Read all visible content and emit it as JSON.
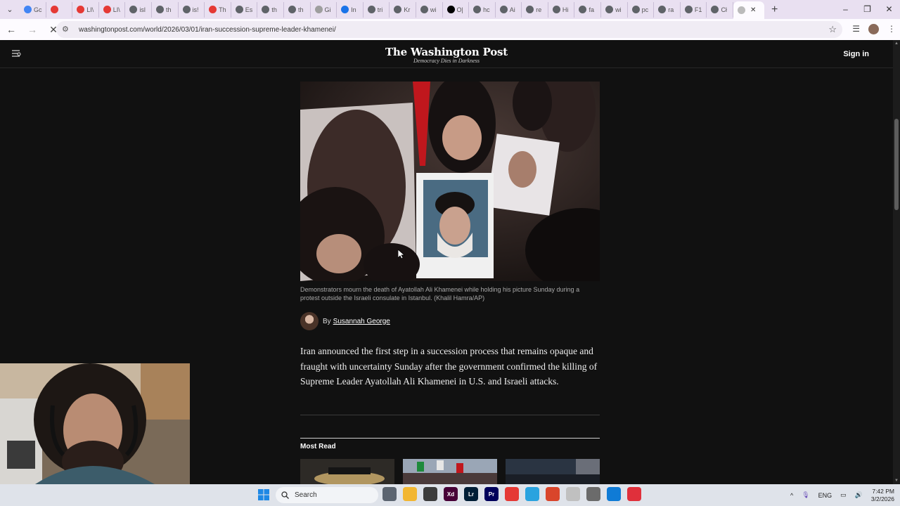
{
  "browser": {
    "tabs": [
      {
        "label": "Gc",
        "color": "#4285f4"
      },
      {
        "label": "",
        "color": "#e53935"
      },
      {
        "label": "LI\\",
        "color": "#e53935"
      },
      {
        "label": "LI\\",
        "color": "#e53935"
      },
      {
        "label": "isl",
        "color": "#5f6368"
      },
      {
        "label": "th",
        "color": "#5f6368"
      },
      {
        "label": "is!",
        "color": "#5f6368"
      },
      {
        "label": "Th",
        "color": "#e53935"
      },
      {
        "label": "Es",
        "color": "#5f6368"
      },
      {
        "label": "th",
        "color": "#5f6368"
      },
      {
        "label": "th",
        "color": "#5f6368"
      },
      {
        "label": "Gi",
        "color": "#9e9e9e"
      },
      {
        "label": "In",
        "color": "#1a73e8"
      },
      {
        "label": "tri",
        "color": "#5f6368"
      },
      {
        "label": "Kr",
        "color": "#5f6368"
      },
      {
        "label": "wi",
        "color": "#5f6368"
      },
      {
        "label": "O|",
        "color": "#000000"
      },
      {
        "label": "hc",
        "color": "#5f6368"
      },
      {
        "label": "Ai",
        "color": "#5f6368"
      },
      {
        "label": "re",
        "color": "#5f6368"
      },
      {
        "label": "Hi",
        "color": "#5f6368"
      },
      {
        "label": "fa",
        "color": "#5f6368"
      },
      {
        "label": "wi",
        "color": "#5f6368"
      },
      {
        "label": "pc",
        "color": "#5f6368"
      },
      {
        "label": "ra",
        "color": "#5f6368"
      },
      {
        "label": "F1",
        "color": "#5f6368"
      },
      {
        "label": "Cł",
        "color": "#5f6368"
      }
    ],
    "active_tab_label": "",
    "url": "washingtonpost.com/world/2026/03/01/iran-succession-supreme-leader-khamenei/",
    "new_tab_symbol": "+",
    "window_controls": [
      "–",
      "❐",
      "✕"
    ]
  },
  "site": {
    "logo": "The Washington Post",
    "tagline": "Democracy Dies in Darkness",
    "signin_label": "Sign in"
  },
  "article": {
    "caption": "Demonstrators mourn the death of Ayatollah Ali Khamenei while holding his picture Sunday during a protest outside the Israeli consulate in Istanbul. (Khalil Hamra/AP)",
    "by_prefix": "By",
    "author": "Susannah George",
    "lede": "Iran announced the first step in a succession process that remains opaque and fraught with uncertainty Sunday after the government confirmed the killing of Supreme Leader Ayatollah Ali Khamenei in U.S. and Israeli attacks.",
    "most_read_label": "Most Read"
  },
  "taskbar": {
    "search_label": "Search",
    "apps": [
      {
        "name": "task-view",
        "label": "",
        "color": "#5b6470"
      },
      {
        "name": "file-explorer",
        "label": "",
        "color": "#f2b632"
      },
      {
        "name": "terminal",
        "label": "",
        "color": "#3c3c3c"
      },
      {
        "name": "adobe-xd",
        "label": "Xd",
        "color": "#470137"
      },
      {
        "name": "lightroom",
        "label": "Lr",
        "color": "#001e36"
      },
      {
        "name": "premiere",
        "label": "Pr",
        "color": "#00005b"
      },
      {
        "name": "chrome",
        "label": "",
        "color": "#e53935"
      },
      {
        "name": "telegram",
        "label": "",
        "color": "#2aa3df"
      },
      {
        "name": "app-red",
        "label": "",
        "color": "#d9452b"
      },
      {
        "name": "app-doc",
        "label": "",
        "color": "#c0c0c0"
      },
      {
        "name": "app-settings",
        "label": "",
        "color": "#6b6b6b"
      },
      {
        "name": "edge",
        "label": "",
        "color": "#0f7bd6"
      },
      {
        "name": "app-red2",
        "label": "",
        "color": "#e0303b"
      }
    ],
    "language": "ENG",
    "time": "7:42 PM",
    "date": "3/2/2026"
  }
}
